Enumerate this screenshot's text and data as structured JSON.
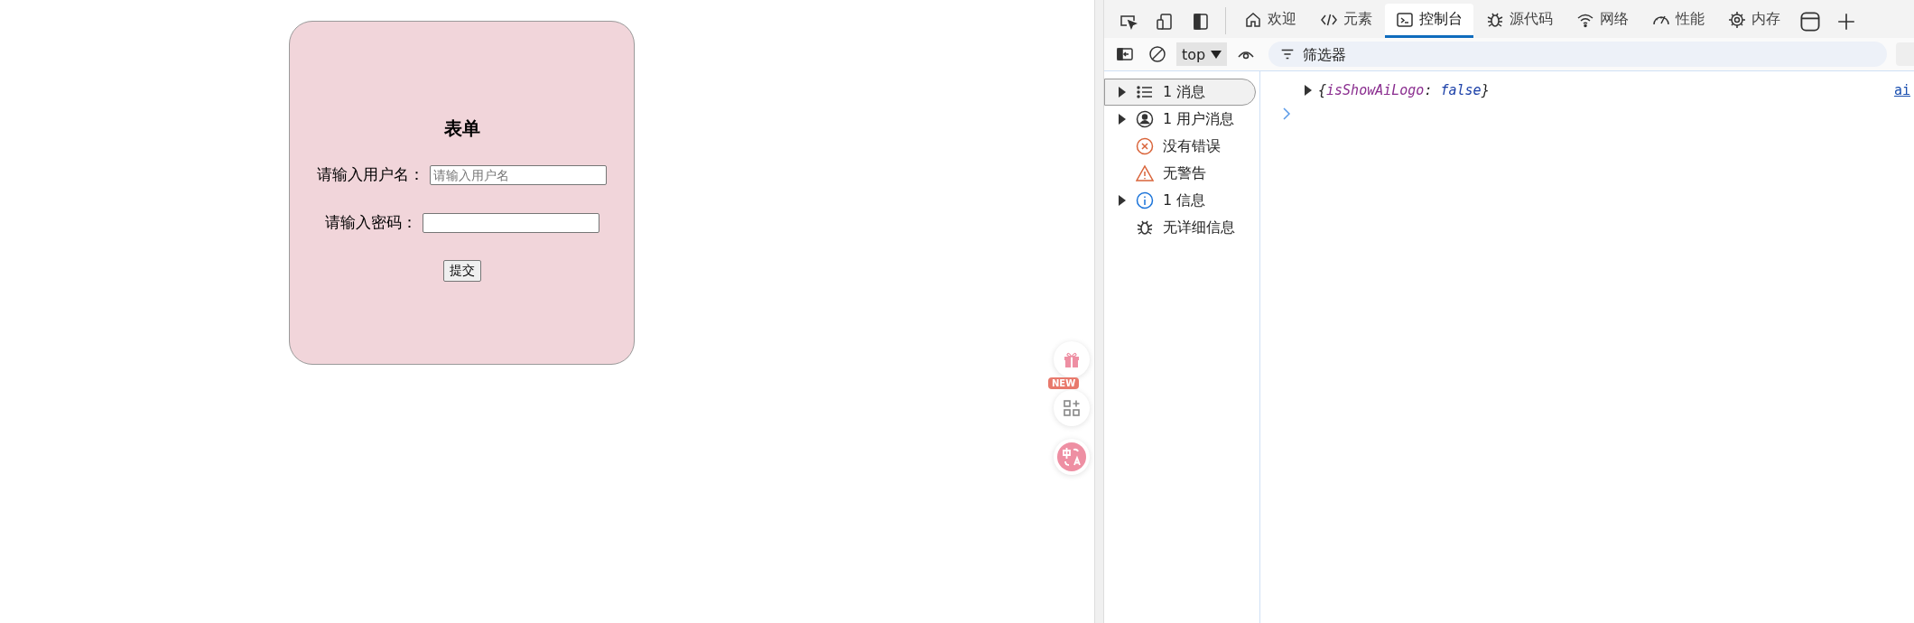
{
  "form": {
    "title": "表单",
    "fields": [
      {
        "label": "请输入用户名：",
        "placeholder": "请输入用户名"
      },
      {
        "label": "请输入密码："
      }
    ],
    "submit": "提交"
  },
  "floating_tools": {
    "badge": "NEW"
  },
  "devtools": {
    "tabs": [
      {
        "label": "欢迎",
        "kind": "home",
        "selected": false
      },
      {
        "label": "元素",
        "kind": "code",
        "selected": false
      },
      {
        "label": "控制台",
        "kind": "console",
        "selected": true
      },
      {
        "label": "源代码",
        "kind": "bug",
        "selected": false
      },
      {
        "label": "网络",
        "kind": "wifi",
        "selected": false
      },
      {
        "label": "性能",
        "kind": "gauge",
        "selected": false
      },
      {
        "label": "内存",
        "kind": "chip",
        "selected": false
      }
    ],
    "context": "top",
    "filter": {
      "placeholder": "筛选器"
    },
    "sidebar": [
      {
        "label": "1 消息",
        "kind": "list",
        "expandable": true,
        "selected": true
      },
      {
        "label": "1 用户消息",
        "kind": "user",
        "expandable": true,
        "selected": false
      },
      {
        "label": "没有错误",
        "kind": "error",
        "expandable": false,
        "selected": false
      },
      {
        "label": "无警告",
        "kind": "warning",
        "expandable": false,
        "selected": false
      },
      {
        "label": "1 信息",
        "kind": "info",
        "expandable": true,
        "selected": false
      },
      {
        "label": "无详细信息",
        "kind": "bug",
        "expandable": false,
        "selected": false
      }
    ],
    "console": {
      "entry": [
        {
          "text": "{",
          "kind": "punct"
        },
        {
          "text": "isShowAiLogo",
          "kind": "key"
        },
        {
          "text": ": ",
          "kind": "punct"
        },
        {
          "text": "false",
          "kind": "value"
        },
        {
          "text": "}",
          "kind": "punct"
        }
      ],
      "source_link": "ai"
    }
  }
}
